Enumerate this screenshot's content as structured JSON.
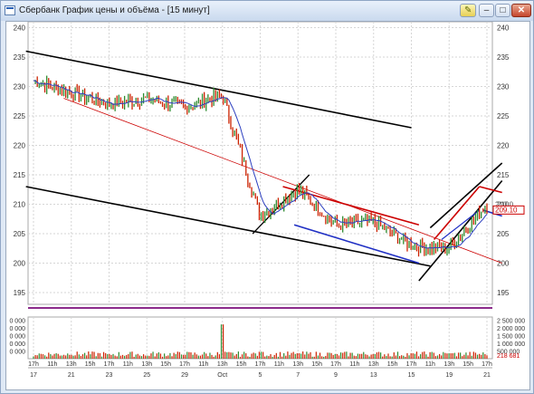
{
  "window": {
    "title": "Сбербанк График цены и объёма - [15 минут]",
    "buttons": {
      "minimize": "–",
      "restore": "□",
      "close": "✕"
    },
    "toolbar_icon": "pencil-icon"
  },
  "price_axis": {
    "ticks": [
      "240",
      "235",
      "230",
      "225",
      "220",
      "215",
      "210",
      "205",
      "200",
      "195"
    ],
    "last_price": "210.0",
    "last_price_marker": "209.10"
  },
  "volume_axis": {
    "ticks": [
      "2 500 000",
      "2 000 000",
      "1 500 000",
      "1 000 000",
      "500 000"
    ],
    "left_ticks": [
      "0 000",
      "0 000",
      "0 000",
      "0 000",
      "0 000"
    ],
    "last_volume": "218 681"
  },
  "time_axis": {
    "hour_ticks": [
      "17h",
      "11h",
      "13h",
      "15h",
      "17h",
      "11h",
      "13h",
      "15h",
      "17h",
      "11h",
      "13h",
      "15h",
      "17h",
      "11h",
      "13h",
      "15h",
      "17h",
      "11h",
      "13h",
      "15h",
      "17h",
      "11h",
      "13h",
      "15h",
      "17h"
    ],
    "date_ticks": [
      "17",
      "21",
      "23",
      "25",
      "29",
      "Oct",
      "5",
      "7",
      "9",
      "13",
      "15",
      "19",
      "21"
    ]
  },
  "colors": {
    "price_bar_up": "#2e8b2e",
    "price_bar_down": "#cc2200",
    "moving_average": "#2c3fc0",
    "channel_black": "#000000",
    "channel_red": "#cc0000",
    "channel_blue": "#1f2fc4",
    "separator": "#8b2b8b",
    "grid": "#d6d6d6"
  },
  "chart_data": [
    {
      "type": "ohlc-line",
      "title": "",
      "series": [
        {
          "name": "",
          "x": [
            "17",
            "21",
            "23",
            "25",
            "29",
            "Oct",
            "5",
            "7",
            "9",
            "13",
            "15",
            "19",
            "21"
          ],
          "values": [
            231.0,
            229.0,
            227.0,
            228.0,
            226.5,
            228.5,
            208.0,
            212.5,
            206.5,
            207.0,
            203.0,
            202.5,
            210.0
          ]
        }
      ],
      "ylim": [
        193,
        241
      ],
      "grid": true
    },
    {
      "type": "bar",
      "title": "",
      "categories": [
        "17",
        "21",
        "23",
        "25",
        "29",
        "Oct",
        "5",
        "7",
        "9",
        "13",
        "15",
        "19",
        "21"
      ],
      "values": [
        150000,
        250000,
        300000,
        200000,
        250000,
        2218681,
        450000,
        350000,
        300000,
        300000,
        350000,
        350000,
        218681
      ],
      "ylim": [
        0,
        2700000
      ]
    }
  ]
}
